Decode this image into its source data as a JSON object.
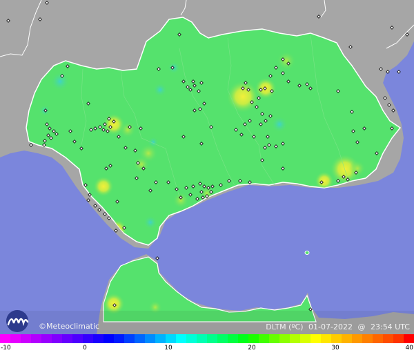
{
  "brand": {
    "name": "Meteoclimatic",
    "copyright_symbol": "©"
  },
  "map": {
    "region": "Andalucía",
    "variable": "DLTM (ºC)",
    "date": "01-07-2022",
    "at": "@",
    "time": "23:54 UTC",
    "sea_color": "#7b86dc",
    "land_color": "#a6a6a6",
    "region_color": "#55e26d"
  },
  "legend": {
    "ticks": [
      "-10",
      "0",
      "10",
      "20",
      "30",
      "40"
    ],
    "colors": [
      "#ff00ff",
      "#e600ff",
      "#cc00ff",
      "#b300ff",
      "#9900ff",
      "#8000ff",
      "#6600ff",
      "#4d00ff",
      "#3300ff",
      "#1a00ff",
      "#0000ff",
      "#001aff",
      "#0040ff",
      "#0066ff",
      "#008cff",
      "#00b3ff",
      "#00d9ff",
      "#00ffff",
      "#00ffd9",
      "#00ffb3",
      "#00ff8c",
      "#00ff66",
      "#00ff40",
      "#00ff1a",
      "#1aff00",
      "#40ff00",
      "#66ff00",
      "#8cff00",
      "#b3ff00",
      "#d9ff00",
      "#ffff00",
      "#ffe600",
      "#ffcc00",
      "#ffb300",
      "#ff9900",
      "#ff8000",
      "#ff6600",
      "#ff4d00",
      "#ff3300",
      "#ff0000"
    ]
  }
}
